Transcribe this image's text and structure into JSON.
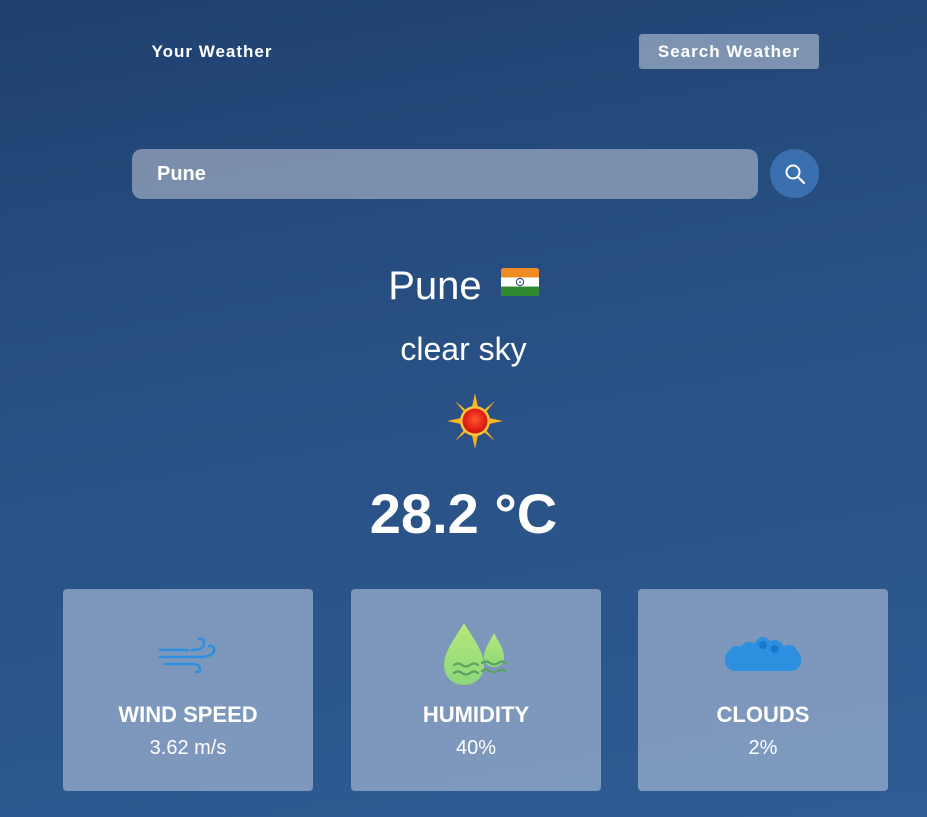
{
  "nav": {
    "your_weather_label": "Your Weather",
    "search_weather_label": "Search Weather"
  },
  "search": {
    "value": "Pune",
    "icon": "search-icon"
  },
  "weather": {
    "city": "Pune",
    "country_flag": "india-flag-icon",
    "description": "clear sky",
    "condition_icon": "sun-icon",
    "temperature": "28.2 °C"
  },
  "stats": {
    "wind": {
      "title": "WIND SPEED",
      "value": "3.62 m/s",
      "icon": "wind-icon"
    },
    "humidity": {
      "title": "HUMIDITY",
      "value": "40%",
      "icon": "humidity-drops-icon"
    },
    "clouds": {
      "title": "CLOUDS",
      "value": "2%",
      "icon": "cloud-icon"
    }
  },
  "colors": {
    "bg_top": "#1f4170",
    "bg_bottom": "#2f5c94",
    "search_button": "#3a6fb0",
    "wind_icon": "#2d8fe0",
    "humidity_icon": "#a6e07a",
    "cloud_icon": "#2d8fe0"
  }
}
